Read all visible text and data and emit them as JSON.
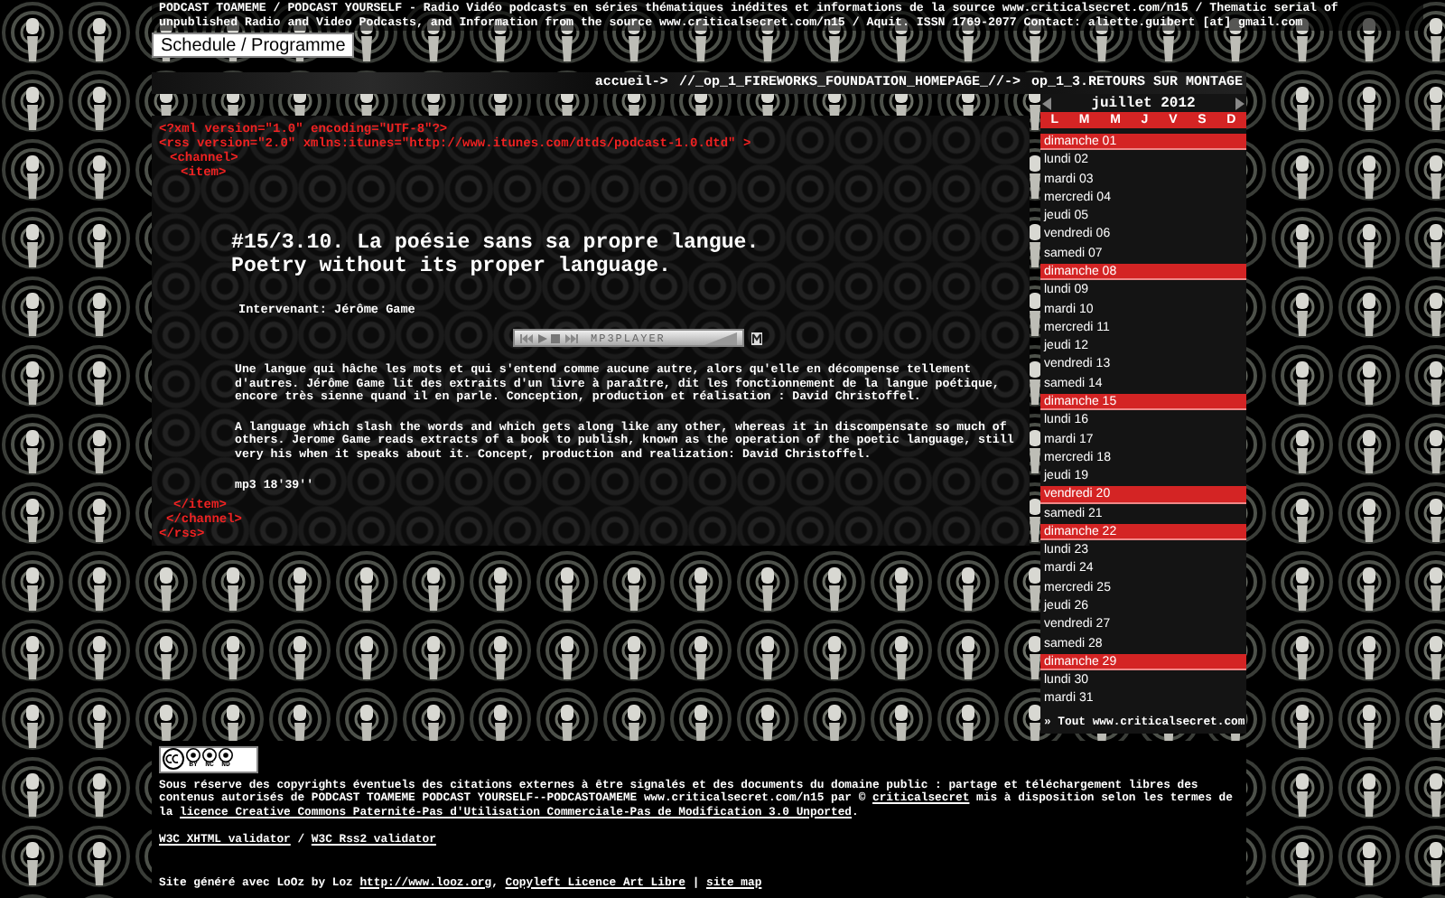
{
  "header_text": "PODCAST TOAMEME / PODCAST YOURSELF - Radio Vidéo podcasts en séries thématiques inédites et informations de la source www.criticalsecret.com/n15 / Thematic serial of unpublished Radio and Video Podcasts, and Information from the source www.criticalsecret.com/n15 / Aquit. ISSN 1769-2077 Contact: aliette.guibert [at] gmail.com",
  "schedule_button": "Schedule / Programme",
  "breadcrumb": [
    "accueil->",
    "//_op_1_FIREWORKS_FOUNDATION_HOMEPAGE_//->",
    "op_1_3.RETOURS SUR MONTAGE"
  ],
  "xml_open": [
    "<?xml version=\"1.0\" encoding=\"UTF-8\"?>",
    "<rss version=\"2.0\" xmlns:itunes=\"http://www.itunes.com/dtds/podcast-1.0.dtd\" >",
    "<channel>",
    "<item>"
  ],
  "title_lines": [
    "#15/3.10. La poésie sans sa propre langue.",
    "Poetry without its proper language."
  ],
  "speaker": "Intervenant: Jérôme Game",
  "player": {
    "label": "MP3PLAYER"
  },
  "paragraphs": [
    "Une langue qui hâche les mots et qui s'entend comme aucune autre, alors qu'elle en décompense tellement d'autres. Jérôme Game lit des extraits d'un livre à paraître, dit les fonctionnement de la langue poétique, encore très sienne quand il en parle. Conception, production et réalisation : David Christoffel.",
    "A language which slash the words and which gets along like any other, whereas it in discompensate so much of others. Jerome Game reads extracts of a book to publish, known as the operation of the poetic language, still very his when it speaks about it. Concept, production and realization: David Christoffel.",
    "mp3 18'39''"
  ],
  "xml_close": [
    "</item>",
    "</channel>",
    "</rss>"
  ],
  "calendar": {
    "month": "juillet 2012",
    "weekdays": [
      "L",
      "M",
      "M",
      "J",
      "V",
      "S",
      "D"
    ],
    "days": [
      {
        "label": "dimanche 01",
        "selected": true
      },
      {
        "label": "lundi 02",
        "selected": false
      },
      {
        "label": "mardi 03",
        "selected": false
      },
      {
        "label": "mercredi 04",
        "selected": false
      },
      {
        "label": "jeudi 05",
        "selected": false
      },
      {
        "label": "vendredi 06",
        "selected": false
      },
      {
        "label": "samedi 07",
        "selected": false
      },
      {
        "label": "dimanche 08",
        "selected": true
      },
      {
        "label": "lundi 09",
        "selected": false
      },
      {
        "label": "mardi 10",
        "selected": false
      },
      {
        "label": "mercredi 11",
        "selected": false
      },
      {
        "label": "jeudi 12",
        "selected": false
      },
      {
        "label": "vendredi 13",
        "selected": false
      },
      {
        "label": "samedi 14",
        "selected": false
      },
      {
        "label": "dimanche 15",
        "selected": true
      },
      {
        "label": "lundi 16",
        "selected": false
      },
      {
        "label": "mardi 17",
        "selected": false
      },
      {
        "label": "mercredi 18",
        "selected": false
      },
      {
        "label": "jeudi 19",
        "selected": false
      },
      {
        "label": "vendredi 20",
        "selected": true
      },
      {
        "label": "samedi 21",
        "selected": false
      },
      {
        "label": "dimanche 22",
        "selected": true
      },
      {
        "label": "lundi 23",
        "selected": false
      },
      {
        "label": "mardi 24",
        "selected": false
      },
      {
        "label": "mercredi 25",
        "selected": false
      },
      {
        "label": "jeudi 26",
        "selected": false
      },
      {
        "label": "vendredi 27",
        "selected": false
      },
      {
        "label": "samedi 28",
        "selected": false
      },
      {
        "label": "dimanche 29",
        "selected": true
      },
      {
        "label": "lundi 30",
        "selected": false
      },
      {
        "label": "mardi 31",
        "selected": false
      }
    ],
    "footer_link": "» Tout www.criticalsecret.com"
  },
  "footer": {
    "license_badge": [
      "BY",
      "NC",
      "ND"
    ],
    "legal": [
      {
        "text": "Sous réserve des copyrights éventuels des citations externes à être signalés et des documents du domaine public : partage et téléchargement libres des contenus autorisés de PODCAST TOAMEME PODCAST YOURSELF--PODCASTOAMEME www.criticalsecret.com/n15 par © ",
        "link": false
      },
      {
        "text": "criticalsecret",
        "link": true
      },
      {
        "text": " mis à disposition selon les termes de la ",
        "link": false
      },
      {
        "text": "licence Creative Commons Paternité-Pas d'Utilisation Commerciale-Pas de Modification 3.0 Unported",
        "link": true
      },
      {
        "text": ".",
        "link": false
      }
    ],
    "validators": [
      "W3C XHTML validator",
      "W3C Rss2 validator"
    ],
    "validator_separator": "/",
    "generated": [
      {
        "text": "Site généré avec LoOz by Loz ",
        "link": false
      },
      {
        "text": "http://www.looz.org",
        "link": true
      },
      {
        "text": ", ",
        "link": false
      },
      {
        "text": "Copyleft Licence Art Libre",
        "link": true
      },
      {
        "text": " | ",
        "link": false
      },
      {
        "text": "site map",
        "link": true
      }
    ]
  }
}
